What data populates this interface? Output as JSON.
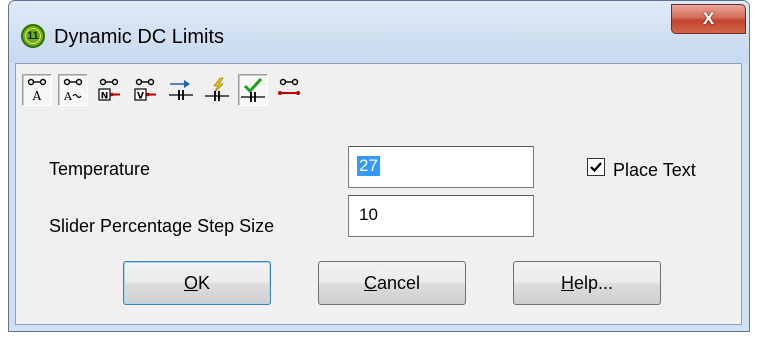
{
  "window": {
    "title": "Dynamic DC Limits",
    "icon_text": "11",
    "close_glyph": "X"
  },
  "toolbar": {
    "buttons": [
      {
        "name": "probe-text-icon",
        "pressed": true
      },
      {
        "name": "probe-wave-icon",
        "pressed": true
      },
      {
        "name": "node-limits-icon",
        "pressed": false
      },
      {
        "name": "voltage-limits-icon",
        "pressed": false
      },
      {
        "name": "current-arrow-icon",
        "pressed": false
      },
      {
        "name": "power-bolt-icon",
        "pressed": false
      },
      {
        "name": "check-pass-icon",
        "pressed": true
      },
      {
        "name": "probe-red-icon",
        "pressed": false
      }
    ]
  },
  "form": {
    "temperature_label": "Temperature",
    "temperature_value": "27",
    "step_label": "Slider Percentage Step Size",
    "step_value": "10",
    "place_text_label": "Place Text",
    "place_text_checked": true
  },
  "buttons": {
    "ok": {
      "mnemonic": "O",
      "rest": "K"
    },
    "cancel": {
      "mnemonic": "C",
      "rest": "ancel"
    },
    "help": {
      "mnemonic": "H",
      "rest": "elp..."
    }
  }
}
